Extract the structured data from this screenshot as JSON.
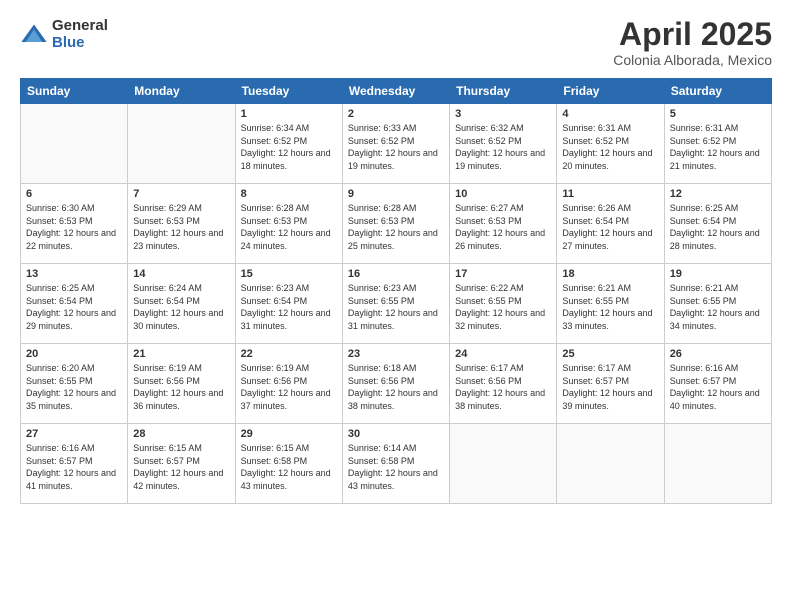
{
  "logo": {
    "general": "General",
    "blue": "Blue"
  },
  "title": "April 2025",
  "subtitle": "Colonia Alborada, Mexico",
  "days_header": [
    "Sunday",
    "Monday",
    "Tuesday",
    "Wednesday",
    "Thursday",
    "Friday",
    "Saturday"
  ],
  "weeks": [
    [
      {
        "num": "",
        "sunrise": "",
        "sunset": "",
        "daylight": "",
        "empty": true
      },
      {
        "num": "",
        "sunrise": "",
        "sunset": "",
        "daylight": "",
        "empty": true
      },
      {
        "num": "1",
        "sunrise": "Sunrise: 6:34 AM",
        "sunset": "Sunset: 6:52 PM",
        "daylight": "Daylight: 12 hours and 18 minutes.",
        "empty": false
      },
      {
        "num": "2",
        "sunrise": "Sunrise: 6:33 AM",
        "sunset": "Sunset: 6:52 PM",
        "daylight": "Daylight: 12 hours and 19 minutes.",
        "empty": false
      },
      {
        "num": "3",
        "sunrise": "Sunrise: 6:32 AM",
        "sunset": "Sunset: 6:52 PM",
        "daylight": "Daylight: 12 hours and 19 minutes.",
        "empty": false
      },
      {
        "num": "4",
        "sunrise": "Sunrise: 6:31 AM",
        "sunset": "Sunset: 6:52 PM",
        "daylight": "Daylight: 12 hours and 20 minutes.",
        "empty": false
      },
      {
        "num": "5",
        "sunrise": "Sunrise: 6:31 AM",
        "sunset": "Sunset: 6:52 PM",
        "daylight": "Daylight: 12 hours and 21 minutes.",
        "empty": false
      }
    ],
    [
      {
        "num": "6",
        "sunrise": "Sunrise: 6:30 AM",
        "sunset": "Sunset: 6:53 PM",
        "daylight": "Daylight: 12 hours and 22 minutes.",
        "empty": false
      },
      {
        "num": "7",
        "sunrise": "Sunrise: 6:29 AM",
        "sunset": "Sunset: 6:53 PM",
        "daylight": "Daylight: 12 hours and 23 minutes.",
        "empty": false
      },
      {
        "num": "8",
        "sunrise": "Sunrise: 6:28 AM",
        "sunset": "Sunset: 6:53 PM",
        "daylight": "Daylight: 12 hours and 24 minutes.",
        "empty": false
      },
      {
        "num": "9",
        "sunrise": "Sunrise: 6:28 AM",
        "sunset": "Sunset: 6:53 PM",
        "daylight": "Daylight: 12 hours and 25 minutes.",
        "empty": false
      },
      {
        "num": "10",
        "sunrise": "Sunrise: 6:27 AM",
        "sunset": "Sunset: 6:53 PM",
        "daylight": "Daylight: 12 hours and 26 minutes.",
        "empty": false
      },
      {
        "num": "11",
        "sunrise": "Sunrise: 6:26 AM",
        "sunset": "Sunset: 6:54 PM",
        "daylight": "Daylight: 12 hours and 27 minutes.",
        "empty": false
      },
      {
        "num": "12",
        "sunrise": "Sunrise: 6:25 AM",
        "sunset": "Sunset: 6:54 PM",
        "daylight": "Daylight: 12 hours and 28 minutes.",
        "empty": false
      }
    ],
    [
      {
        "num": "13",
        "sunrise": "Sunrise: 6:25 AM",
        "sunset": "Sunset: 6:54 PM",
        "daylight": "Daylight: 12 hours and 29 minutes.",
        "empty": false
      },
      {
        "num": "14",
        "sunrise": "Sunrise: 6:24 AM",
        "sunset": "Sunset: 6:54 PM",
        "daylight": "Daylight: 12 hours and 30 minutes.",
        "empty": false
      },
      {
        "num": "15",
        "sunrise": "Sunrise: 6:23 AM",
        "sunset": "Sunset: 6:54 PM",
        "daylight": "Daylight: 12 hours and 31 minutes.",
        "empty": false
      },
      {
        "num": "16",
        "sunrise": "Sunrise: 6:23 AM",
        "sunset": "Sunset: 6:55 PM",
        "daylight": "Daylight: 12 hours and 31 minutes.",
        "empty": false
      },
      {
        "num": "17",
        "sunrise": "Sunrise: 6:22 AM",
        "sunset": "Sunset: 6:55 PM",
        "daylight": "Daylight: 12 hours and 32 minutes.",
        "empty": false
      },
      {
        "num": "18",
        "sunrise": "Sunrise: 6:21 AM",
        "sunset": "Sunset: 6:55 PM",
        "daylight": "Daylight: 12 hours and 33 minutes.",
        "empty": false
      },
      {
        "num": "19",
        "sunrise": "Sunrise: 6:21 AM",
        "sunset": "Sunset: 6:55 PM",
        "daylight": "Daylight: 12 hours and 34 minutes.",
        "empty": false
      }
    ],
    [
      {
        "num": "20",
        "sunrise": "Sunrise: 6:20 AM",
        "sunset": "Sunset: 6:55 PM",
        "daylight": "Daylight: 12 hours and 35 minutes.",
        "empty": false
      },
      {
        "num": "21",
        "sunrise": "Sunrise: 6:19 AM",
        "sunset": "Sunset: 6:56 PM",
        "daylight": "Daylight: 12 hours and 36 minutes.",
        "empty": false
      },
      {
        "num": "22",
        "sunrise": "Sunrise: 6:19 AM",
        "sunset": "Sunset: 6:56 PM",
        "daylight": "Daylight: 12 hours and 37 minutes.",
        "empty": false
      },
      {
        "num": "23",
        "sunrise": "Sunrise: 6:18 AM",
        "sunset": "Sunset: 6:56 PM",
        "daylight": "Daylight: 12 hours and 38 minutes.",
        "empty": false
      },
      {
        "num": "24",
        "sunrise": "Sunrise: 6:17 AM",
        "sunset": "Sunset: 6:56 PM",
        "daylight": "Daylight: 12 hours and 38 minutes.",
        "empty": false
      },
      {
        "num": "25",
        "sunrise": "Sunrise: 6:17 AM",
        "sunset": "Sunset: 6:57 PM",
        "daylight": "Daylight: 12 hours and 39 minutes.",
        "empty": false
      },
      {
        "num": "26",
        "sunrise": "Sunrise: 6:16 AM",
        "sunset": "Sunset: 6:57 PM",
        "daylight": "Daylight: 12 hours and 40 minutes.",
        "empty": false
      }
    ],
    [
      {
        "num": "27",
        "sunrise": "Sunrise: 6:16 AM",
        "sunset": "Sunset: 6:57 PM",
        "daylight": "Daylight: 12 hours and 41 minutes.",
        "empty": false
      },
      {
        "num": "28",
        "sunrise": "Sunrise: 6:15 AM",
        "sunset": "Sunset: 6:57 PM",
        "daylight": "Daylight: 12 hours and 42 minutes.",
        "empty": false
      },
      {
        "num": "29",
        "sunrise": "Sunrise: 6:15 AM",
        "sunset": "Sunset: 6:58 PM",
        "daylight": "Daylight: 12 hours and 43 minutes.",
        "empty": false
      },
      {
        "num": "30",
        "sunrise": "Sunrise: 6:14 AM",
        "sunset": "Sunset: 6:58 PM",
        "daylight": "Daylight: 12 hours and 43 minutes.",
        "empty": false
      },
      {
        "num": "",
        "sunrise": "",
        "sunset": "",
        "daylight": "",
        "empty": true
      },
      {
        "num": "",
        "sunrise": "",
        "sunset": "",
        "daylight": "",
        "empty": true
      },
      {
        "num": "",
        "sunrise": "",
        "sunset": "",
        "daylight": "",
        "empty": true
      }
    ]
  ]
}
